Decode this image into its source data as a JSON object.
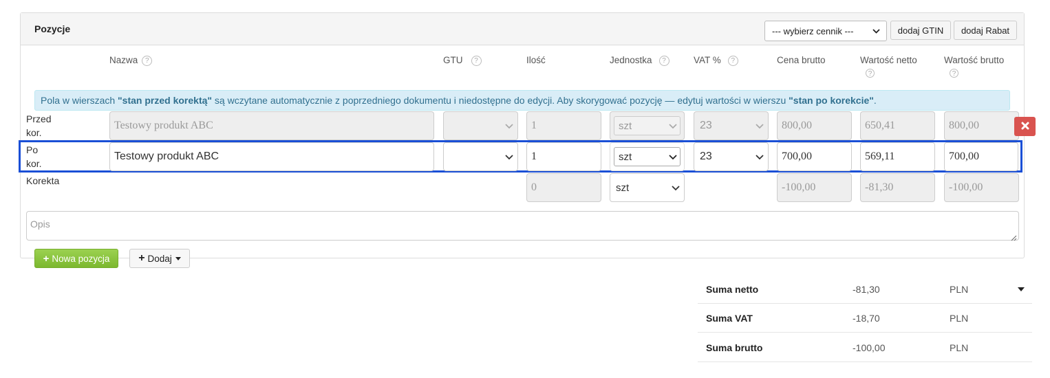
{
  "panel": {
    "title": "Pozycje",
    "cennik_select": "--- wybierz cennik ---",
    "gtin_button": "dodaj GTIN",
    "rabat_button": "dodaj Rabat"
  },
  "columns": {
    "nazwa": "Nazwa",
    "gtu": "GTU",
    "ilosc": "Ilość",
    "jednostka": "Jednostka",
    "vat": "VAT %",
    "cena_brutto": "Cena brutto",
    "wartosc_netto": "Wartość netto",
    "wartosc_brutto": "Wartość brutto"
  },
  "info": {
    "part1": "Pola w wierszach ",
    "bold1": "\"stan przed korektą\"",
    "part2": " są wczytane automatycznie z poprzedniego dokumentu i niedostępne do edycji. Aby skorygować pozycję — edytuj wartości w wierszu ",
    "bold2": "\"stan po korekcie\"",
    "part3": "."
  },
  "rows": {
    "before": {
      "label_1": "Przed",
      "label_2": "kor.",
      "name": "Testowy produkt ABC",
      "gtu": "",
      "qty": "1",
      "unit": "szt",
      "vat": "23",
      "gross_price": "800,00",
      "net_value": "650,41",
      "gross_value": "800,00"
    },
    "after": {
      "label_1": "Po",
      "label_2": "kor.",
      "name": "Testowy produkt ABC",
      "gtu": "",
      "qty": "1",
      "unit": "szt",
      "vat": "23",
      "gross_price": "700,00",
      "net_value": "569,11",
      "gross_value": "700,00"
    },
    "correction": {
      "label": "Korekta",
      "qty": "0",
      "unit": "szt",
      "gross_price": "-100,00",
      "net_value": "-81,30",
      "gross_value": "-100,00"
    }
  },
  "opis_placeholder": "Opis",
  "buttons": {
    "new_position": "Nowa pozycja",
    "add": "Dodaj"
  },
  "summary": [
    {
      "label": "Suma netto",
      "value": "-81,30",
      "currency": "PLN"
    },
    {
      "label": "Suma VAT",
      "value": "-18,70",
      "currency": "PLN"
    },
    {
      "label": "Suma brutto",
      "value": "-100,00",
      "currency": "PLN"
    }
  ],
  "colors": {
    "highlight": "#1a4fd6",
    "delete": "#d9534f",
    "green": "#8dc63f",
    "info_bg": "#d9edf7",
    "info_text": "#31708f"
  }
}
